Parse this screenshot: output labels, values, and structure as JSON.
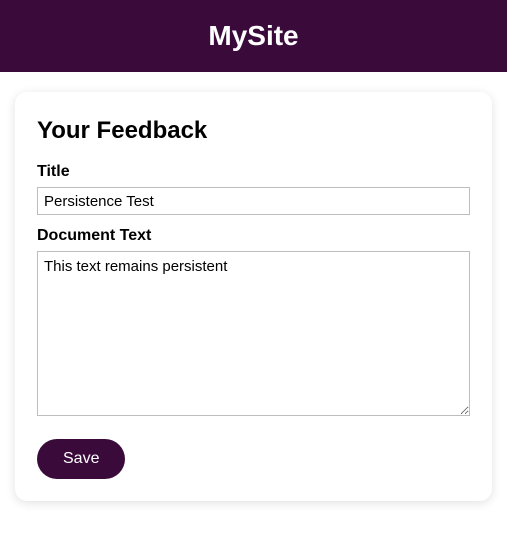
{
  "header": {
    "site_name": "MySite"
  },
  "form": {
    "heading": "Your Feedback",
    "title_label": "Title",
    "title_value": "Persistence Test",
    "document_label": "Document Text",
    "document_value": "This text remains persistent",
    "save_label": "Save"
  },
  "colors": {
    "brand": "#3a0a3a"
  }
}
